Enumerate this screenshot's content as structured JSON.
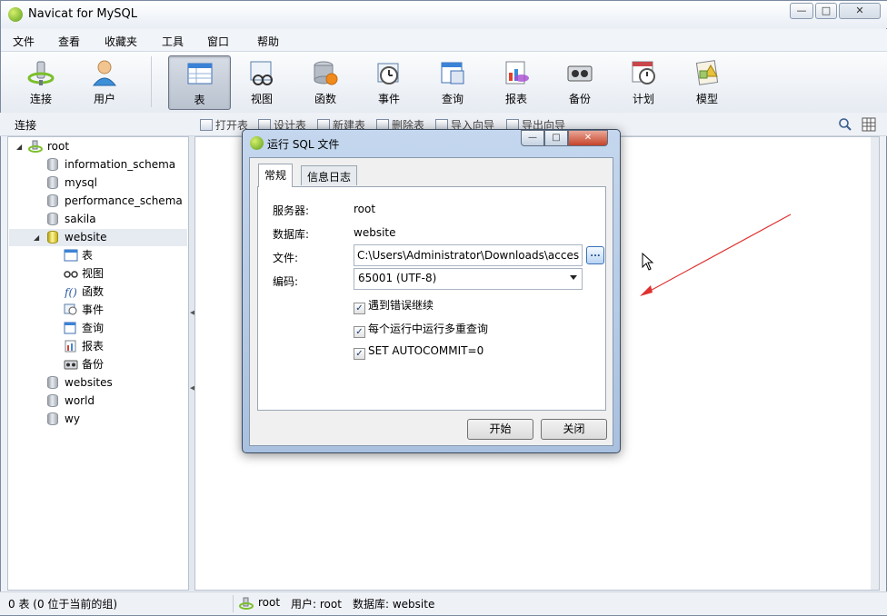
{
  "window": {
    "title": "Navicat for MySQL",
    "min_label": "—",
    "max_label": "□",
    "close_label": "✕"
  },
  "menu": [
    "文件",
    "查看",
    "收藏夹",
    "工具",
    "窗口",
    "帮助"
  ],
  "toolbar": {
    "connect": "连接",
    "user": "用户",
    "table": "表",
    "view": "视图",
    "function": "函数",
    "event": "事件",
    "query": "查询",
    "report": "报表",
    "backup": "备份",
    "schedule": "计划",
    "model": "模型"
  },
  "subbar": {
    "label": "连接",
    "open_table": "打开表",
    "design_table": "设计表",
    "new_table": "新建表",
    "delete_table": "删除表",
    "import_wizard": "导入向导",
    "export_wizard": "导出向导"
  },
  "tree": {
    "root": "root",
    "databases": [
      "information_schema",
      "mysql",
      "performance_schema",
      "sakila",
      "website"
    ],
    "website_children": [
      "表",
      "视图",
      "函数",
      "事件",
      "查询",
      "报表",
      "备份"
    ],
    "more_databases": [
      "websites",
      "world",
      "wy"
    ]
  },
  "status": {
    "left": "0 表 (0 位于当前的组)",
    "conn": "root",
    "user": "用户: root",
    "db": "数据库: website"
  },
  "dialog": {
    "title": "运行 SQL 文件",
    "tabs": [
      "常规",
      "信息日志"
    ],
    "server_label": "服务器:",
    "server_value": "root",
    "db_label": "数据库:",
    "db_value": "website",
    "file_label": "文件:",
    "file_value": "C:\\Users\\Administrator\\Downloads\\access",
    "browse_label": "...",
    "encoding_label": "编码:",
    "encoding_value": "65001 (UTF-8)",
    "opt_continue": "遇到错误继续",
    "opt_multi": "每个运行中运行多重查询",
    "opt_autocommit": "SET AUTOCOMMIT=0",
    "start_button": "开始",
    "close_button": "关闭"
  },
  "colors": {
    "accent": "#6b7585",
    "annotation_arrow": "#e03030",
    "selection": "#e6ebf1"
  }
}
